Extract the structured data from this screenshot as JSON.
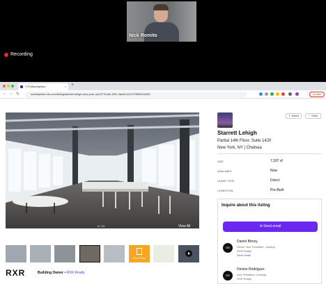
{
  "meeting": {
    "participant_name": "Nick Romito",
    "recording_label": "Recording"
  },
  "browser": {
    "tab_title": "775 Marketplace",
    "tab_close": "×",
    "new_tab": "+",
    "url": "marketplace.vts.com/listing/starrett-lehigh-new-york-nyC077b4de-4f01-4ae6b-b03-97f6822b1853",
    "update_label": "Update"
  },
  "gallery": {
    "counter": "4 / 14",
    "view_all": "View All",
    "floorplan_label": "Floor Plan"
  },
  "owner": {
    "logo": "RXR",
    "label": "Building Owner",
    "separator": " • ",
    "name": "RXR Realty"
  },
  "listing": {
    "share": "Share",
    "save": "Save",
    "building_name": "Starrett Lehigh",
    "suite": "Partial 14th Floor, Suite 1420",
    "location": "New York, NY  |  Chelsea",
    "facts": [
      {
        "label": "Size",
        "value": "7,187 sf"
      },
      {
        "label": "Available",
        "value": "Now"
      },
      {
        "label": "Lease Type",
        "value": "Direct"
      },
      {
        "label": "Condition",
        "value": "Pre-Built"
      }
    ]
  },
  "inquire": {
    "title": "Inquire about this listing",
    "send_email": "Send email",
    "brokers": [
      {
        "initials": "DB",
        "name": "Daniel Birney",
        "title": "Senior Vice President, Leasing",
        "company": "RXR Realty",
        "email": "Send email"
      },
      {
        "initials": "DR",
        "name": "Denise Rodriguez",
        "title": "Vice President, Leasing",
        "company": "RXR Realty",
        "email": "Send email"
      }
    ]
  }
}
